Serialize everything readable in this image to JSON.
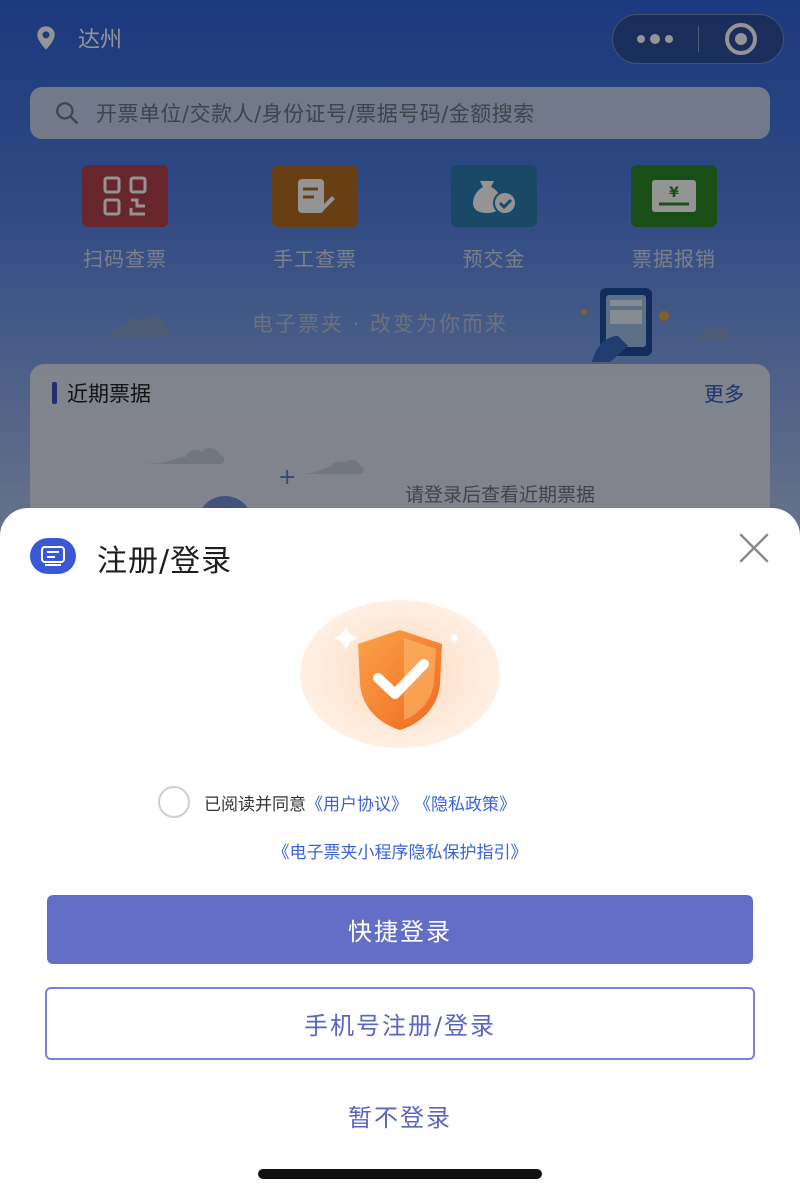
{
  "header": {
    "location": "达州",
    "location_icon": "location-pin-icon",
    "menu_icon": "more-dots-icon",
    "record_icon": "target-icon"
  },
  "search": {
    "placeholder": "开票单位/交款人/身份证号/票据号码/金额搜索"
  },
  "quick_actions": [
    {
      "label": "扫码查票",
      "icon": "qr-code-icon",
      "color": "#b6434c"
    },
    {
      "label": "手工查票",
      "icon": "edit-document-icon",
      "color": "#b46d1f"
    },
    {
      "label": "预交金",
      "icon": "money-bag-icon",
      "color": "#2b7fb0"
    },
    {
      "label": "票据报销",
      "icon": "receipt-yen-icon",
      "color": "#2e8a2a"
    }
  ],
  "slogan": "电子票夹 · 改变为你而来",
  "recent": {
    "title": "近期票据",
    "more": "更多",
    "empty_text": "请登录后查看近期票据"
  },
  "sheet": {
    "title": "注册/登录",
    "agree_prefix": "已阅读并同意",
    "user_agreement": "《用户协议》",
    "privacy_policy": "《隐私政策》",
    "privacy_guide": "《电子票夹小程序隐私保护指引》",
    "quick_login": "快捷登录",
    "phone_login": "手机号注册/登录",
    "skip_login": "暂不登录"
  },
  "colors": {
    "primary": "#636fc6",
    "link": "#3a63d8",
    "accent_orange": "#f5862f"
  }
}
